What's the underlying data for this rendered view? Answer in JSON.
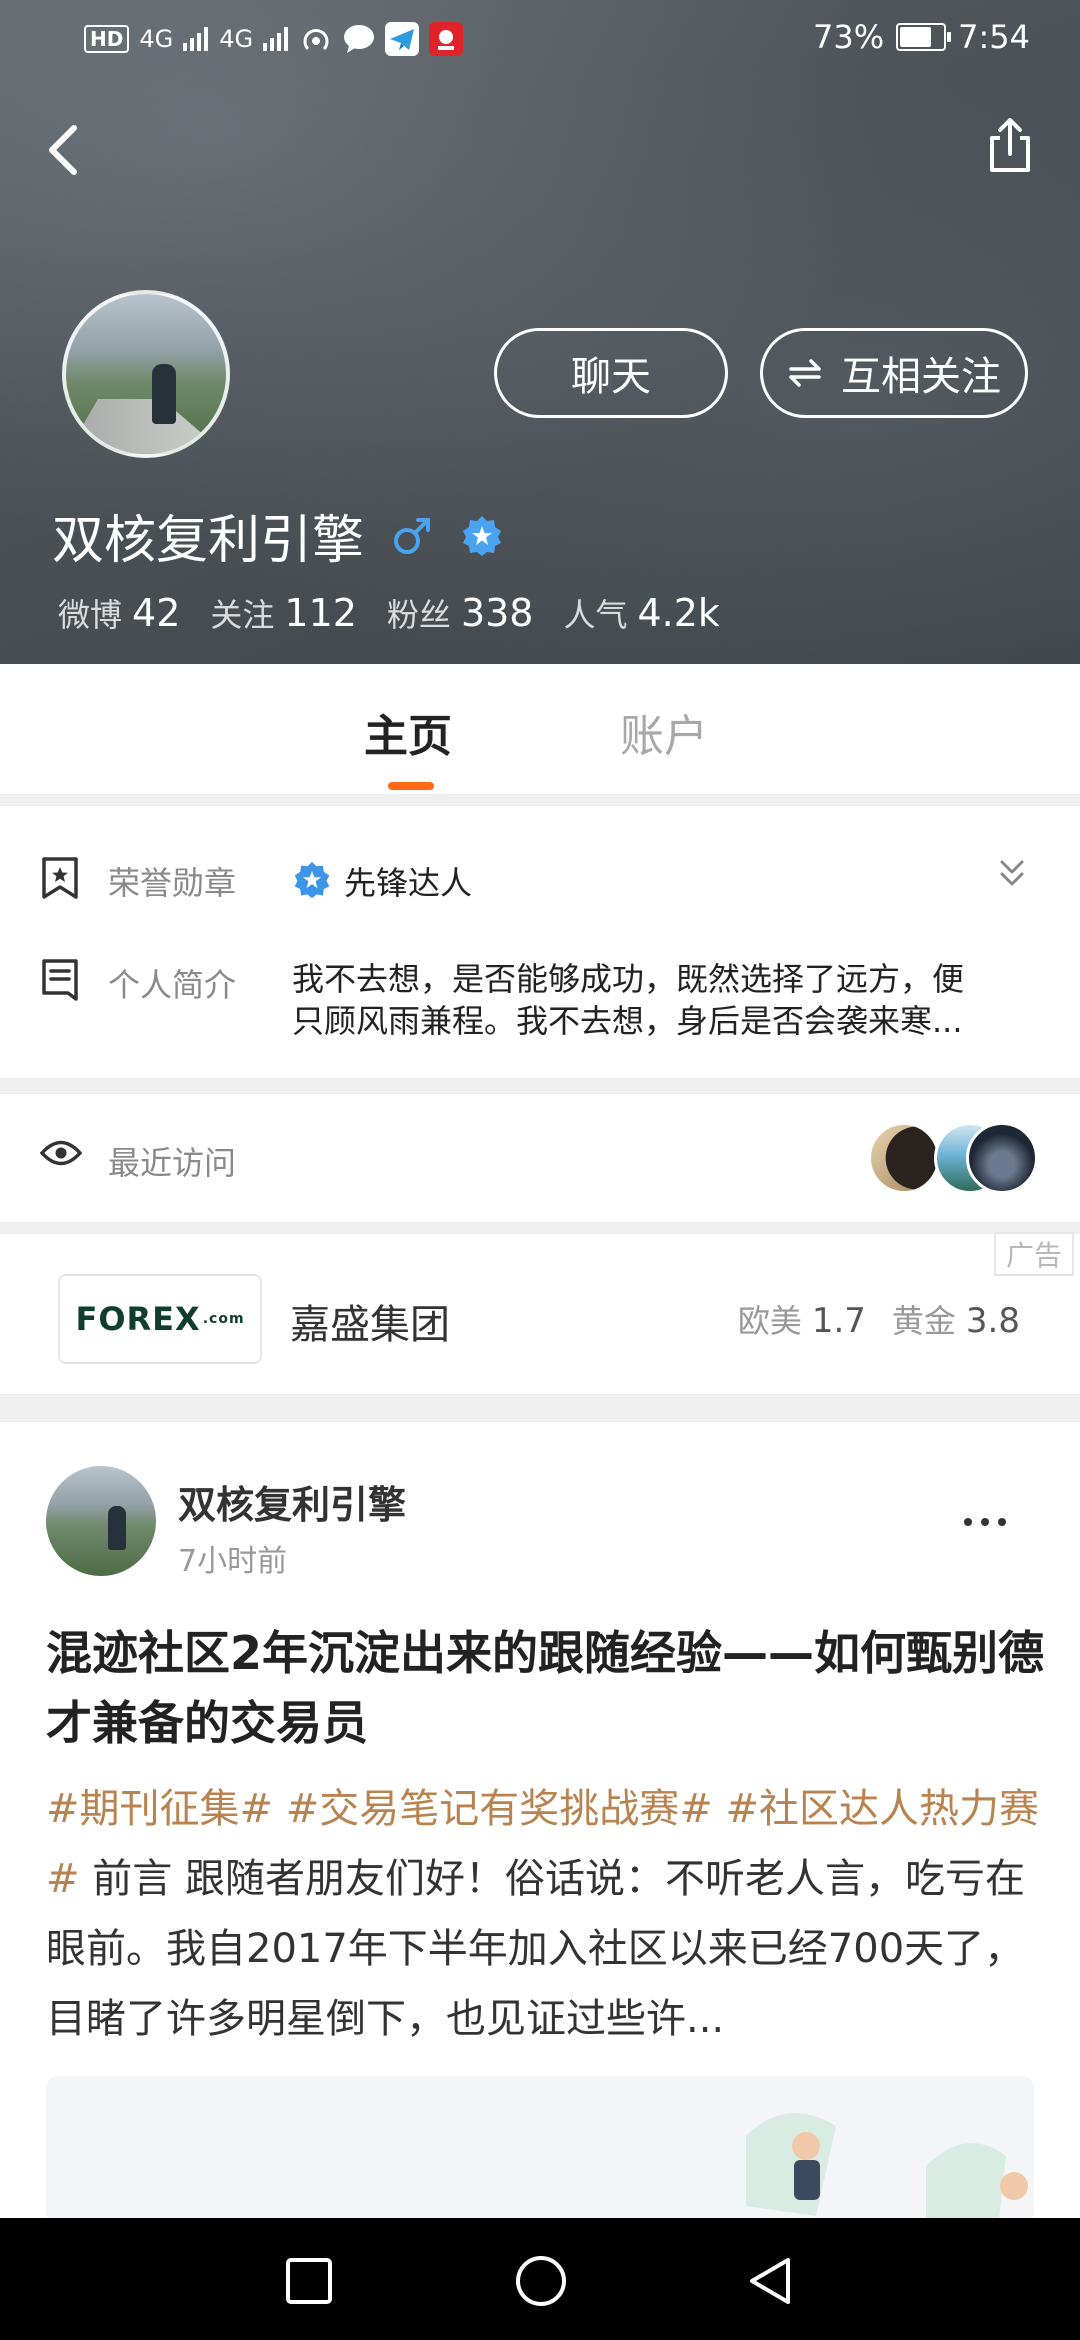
{
  "status_bar": {
    "network_label": "HD",
    "signal_1": "4G",
    "signal_2": "4G",
    "battery_percent_text": "73%",
    "battery_level": 0.73,
    "time": "7:54"
  },
  "header": {
    "back_icon": "back-arrow-icon",
    "share_icon": "share-icon",
    "chat_label": "聊天",
    "mutual_follow_label": "互相关注",
    "username": "双核复利引擎",
    "stats": [
      {
        "label": "微博",
        "value": "42"
      },
      {
        "label": "关注",
        "value": "112"
      },
      {
        "label": "粉丝",
        "value": "338"
      },
      {
        "label": "人气",
        "value": "4.2k"
      }
    ]
  },
  "tabs": {
    "home": "主页",
    "account": "账户",
    "accent_color": "#ff6a13"
  },
  "info": {
    "badge_label": "荣誉勋章",
    "badge_name": "先锋达人",
    "bio_label": "个人简介",
    "bio_line1": "我不去想，是否能够成功，既然选择了远方，便",
    "bio_line2": "只顾风雨兼程。我不去想，身后是否会袭来寒..."
  },
  "recent_visits": {
    "label": "最近访问"
  },
  "ad": {
    "tag": "广告",
    "logo_text": "FOREX",
    "logo_suffix": ".com",
    "name": "嘉盛集团",
    "quote1_label": "欧美",
    "quote1_value": "1.7",
    "quote2_label": "黄金",
    "quote2_value": "3.8"
  },
  "post": {
    "author": "双核复利引擎",
    "time": "7小时前",
    "title": "混迹社区2年沉淀出来的跟随经验——如何甄别德才兼备的交易员",
    "hashtag1": "#期刊征集#",
    "hashtag2": "#交易笔记有奖挑战赛#",
    "hashtag3": "#社区达人热力赛#",
    "body": "前言 跟随者朋友们好！俗话说：不听老人言，吃亏在眼前。我自2017年下半年加入社区以来已经700天了，目睹了许多明星倒下，也见证过些许..."
  },
  "nav": {
    "recents_icon": "square-icon",
    "home_icon": "circle-icon",
    "back_icon": "triangle-back-icon"
  }
}
